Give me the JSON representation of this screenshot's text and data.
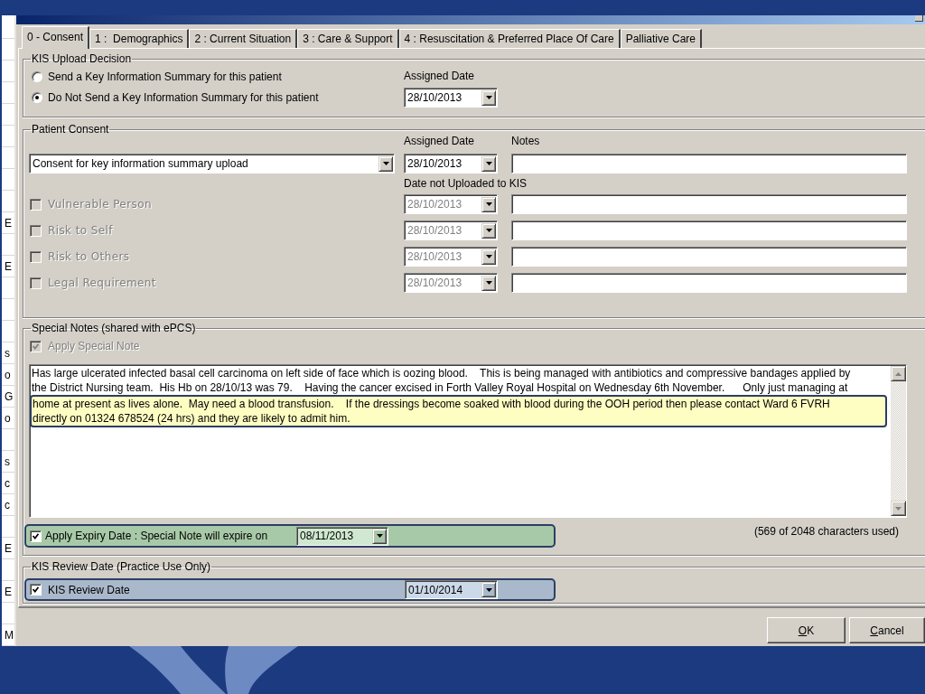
{
  "background_window": {
    "rows": [
      {
        "kind": "blank"
      },
      {
        "kind": "blank"
      },
      {
        "kind": "blank"
      },
      {
        "kind": "blank"
      },
      {
        "kind": "blank"
      },
      {
        "kind": "blank"
      },
      {
        "kind": "blank"
      },
      {
        "kind": "blank"
      },
      {
        "kind": "blank"
      },
      {
        "kind": "text",
        "text": "E"
      },
      {
        "kind": "blank"
      },
      {
        "kind": "text",
        "text": "E"
      },
      {
        "kind": "blank"
      },
      {
        "kind": "blank"
      },
      {
        "kind": "blank"
      },
      {
        "kind": "text",
        "text": "s"
      },
      {
        "kind": "text",
        "text": "o"
      },
      {
        "kind": "text",
        "text": "G"
      },
      {
        "kind": "text",
        "text": "o"
      },
      {
        "kind": "blank"
      },
      {
        "kind": "text",
        "text": "s"
      },
      {
        "kind": "text",
        "text": "c"
      },
      {
        "kind": "text",
        "text": "c"
      },
      {
        "kind": "blank"
      },
      {
        "kind": "text",
        "text": "E"
      },
      {
        "kind": "blank"
      },
      {
        "kind": "text",
        "text": "E"
      },
      {
        "kind": "blank"
      },
      {
        "kind": "text",
        "text": "M"
      }
    ]
  },
  "tabs": [
    {
      "label": "0 - Consent",
      "selected": true
    },
    {
      "label": "1 :  Demographics",
      "selected": false
    },
    {
      "label": "2 : Current Situation",
      "selected": false
    },
    {
      "label": "3 : Care & Support",
      "selected": false
    },
    {
      "label": "4 : Resuscitation & Preferred Place Of Care",
      "selected": false
    },
    {
      "label": "Palliative Care",
      "selected": false
    }
  ],
  "upload_decision": {
    "title": "KIS Upload Decision",
    "options": [
      {
        "label": "Send a Key Information Summary for this patient",
        "selected": false
      },
      {
        "label": "Do Not Send a Key Information Summary for this patient",
        "selected": true
      }
    ],
    "date_label": "Assigned Date",
    "date": "28/10/2013"
  },
  "patient_consent": {
    "title": "Patient Consent",
    "date_label": "Assigned Date",
    "notes_label": "Notes",
    "consent": "Consent for key information summary upload",
    "date": "28/10/2013",
    "not_uploaded_label": "Date not Uploaded to KIS",
    "reasons": [
      {
        "label": "Vulnerable Person",
        "checked": false,
        "disabled": true,
        "date": "28/10/2013"
      },
      {
        "label": "Risk to Self",
        "checked": false,
        "disabled": true,
        "date": "28/10/2013"
      },
      {
        "label": "Risk to Others",
        "checked": false,
        "disabled": true,
        "date": "28/10/2013"
      },
      {
        "label": "Legal Requirement",
        "checked": false,
        "disabled": true,
        "date": "28/10/2013"
      }
    ]
  },
  "special_notes": {
    "title": "Special Notes (shared with ePCS)",
    "apply": {
      "label": "Apply Special Note",
      "checked": true,
      "disabled": true
    },
    "note_text": "Has large ulcerated infected basal cell carcinoma on left side of face which is oozing blood.    This is being managed with antibiotics and compressive bandages applied by\nthe District Nursing team.  His Hb on 28/10/13 was 79.    Having the cancer excised in Forth Valley Royal Hospital on Wednesday 6th November.      Only just managing at",
    "highlighted_note_text": "home at present as lives alone.  May need a blood transfusion.    If the dressings become soaked with blood during the OOH period then please contact Ward 6 FVRH\ndirectly on 01324 678524 (24 hrs) and they are likely to admit him.",
    "expiry": {
      "label": "Apply Expiry Date : Special Note will expire on",
      "checked": true,
      "highlighted": true,
      "date": "08/11/2013"
    },
    "character_count": "(569 of 2048 characters used)"
  },
  "review": {
    "title": "KIS Review Date (Practice Use Only)",
    "label": "KIS Review Date",
    "checked": true,
    "highlighted": true,
    "date": "01/10/2014"
  },
  "buttons": [
    {
      "label": "OK"
    },
    {
      "label": "Cancel"
    }
  ]
}
